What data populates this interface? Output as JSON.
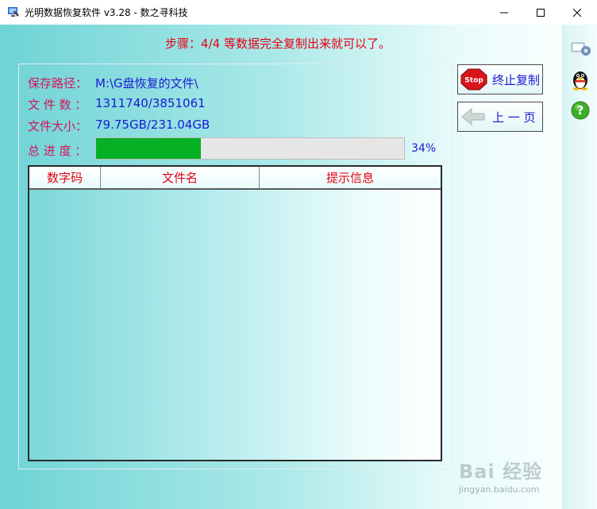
{
  "window": {
    "title": "光明数据恢复软件 v3.28 - 数之寻科技",
    "minimize_icon": "minimize-icon",
    "maximize_icon": "maximize-icon",
    "close_icon": "close-icon"
  },
  "step": {
    "text": "步骤：4/4 等数据完全复制出来就可以了。"
  },
  "info": {
    "path_label": "保存路径：",
    "path_value": "M:\\G盘恢复的文件\\",
    "files_label": "文 件 数 ：",
    "files_value": "1311740/3851061",
    "size_label": "文件大小：",
    "size_value": "79.75GB/231.04GB",
    "progress_label": "总 进 度 ：",
    "progress_percent_text": "34%",
    "progress_fraction": 0.34
  },
  "table": {
    "columns": [
      "数字码",
      "文件名",
      "提示信息"
    ],
    "rows": []
  },
  "buttons": {
    "stop_label": "终止复制",
    "stop_icon_text": "Stop",
    "back_label": "上 一 页"
  },
  "sidebar": {
    "icons": [
      "network-settings-icon",
      "qq-penguin-icon",
      "help-icon"
    ]
  },
  "watermark": {
    "text": "Bai 经验",
    "url": "jingyan.baidu.com"
  },
  "colors": {
    "accent_red": "#e60012",
    "label_pink": "#d4145a",
    "value_blue": "#1a1ad4",
    "progress_green": "#06b025"
  }
}
